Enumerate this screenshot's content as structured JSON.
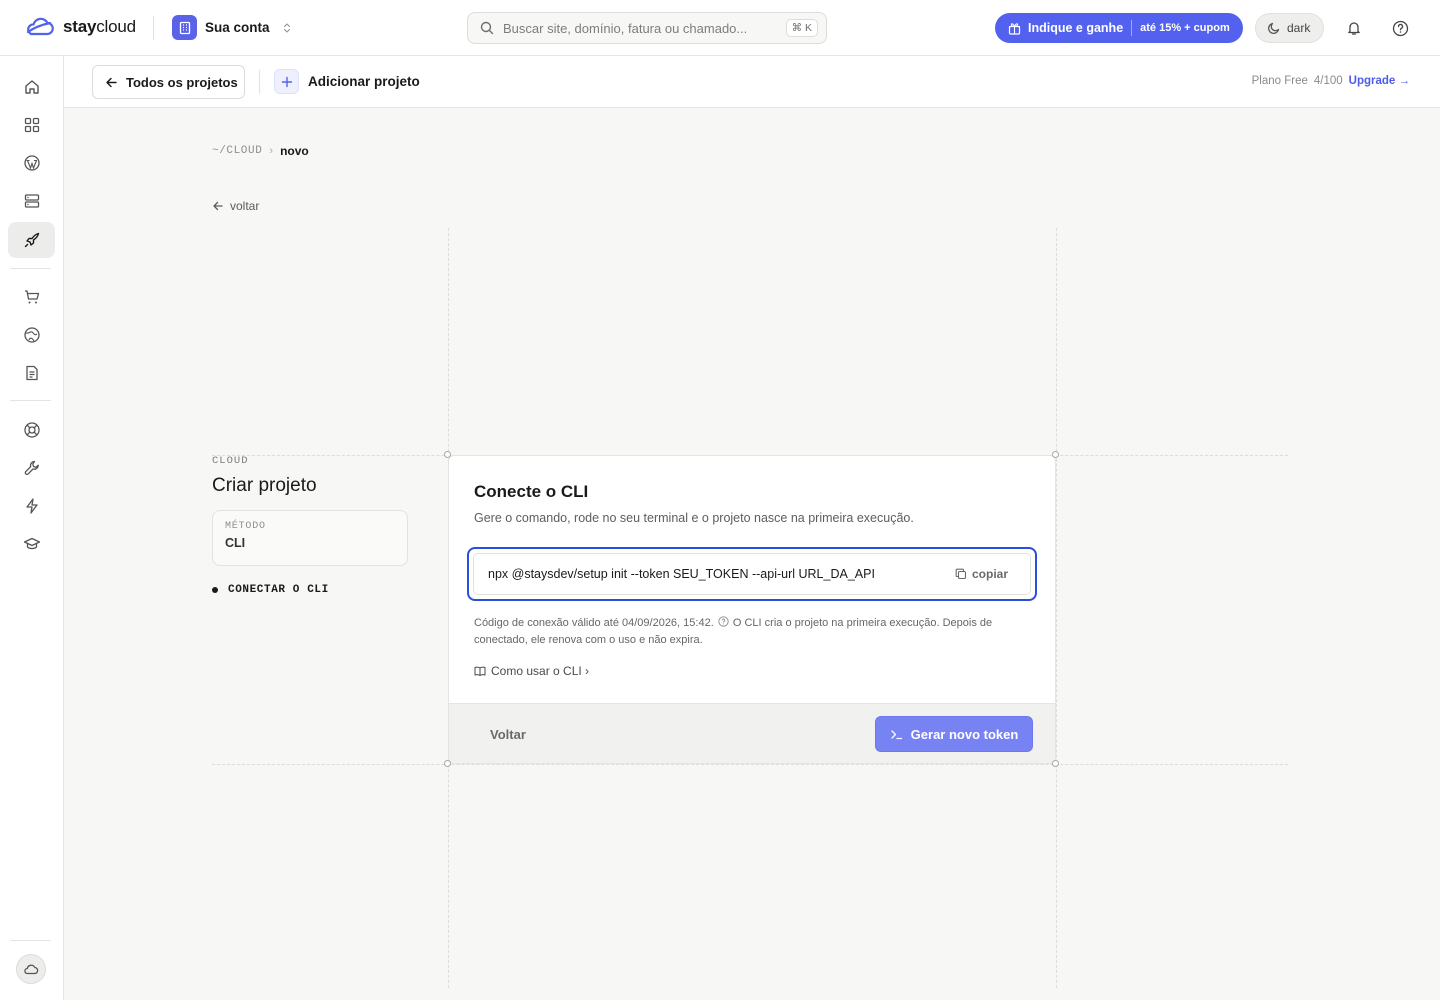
{
  "brand": {
    "name_bold": "stay",
    "name_light": "cloud"
  },
  "account": {
    "label": "Sua conta"
  },
  "search": {
    "placeholder": "Buscar site, domínio, fatura ou chamado...",
    "shortcut": "⌘ K"
  },
  "promo": {
    "label": "Indique e ganhe",
    "detail": "até 15% + cupom"
  },
  "theme_toggle": {
    "label": "dark"
  },
  "subheader": {
    "all_projects": "Todos os projetos",
    "add_project": "Adicionar projeto",
    "plan_label": "Plano Free",
    "plan_usage": "4/100",
    "upgrade": "Upgrade →"
  },
  "breadcrumb": {
    "root": "~/CLOUD",
    "separator": "›",
    "current": "novo"
  },
  "back_link": "voltar",
  "left_panel": {
    "eyebrow": "CLOUD",
    "title": "Criar projeto",
    "method_label": "MÉTODO",
    "method_value": "CLI",
    "step": "CONECTAR O CLI"
  },
  "card": {
    "title": "Conecte o CLI",
    "subtitle": "Gere o comando, rode no seu terminal e o projeto nasce na primeira execução.",
    "command": "npx @staysdev/setup init --token SEU_TOKEN --api-url URL_DA_API",
    "copy_label": "copiar",
    "note_part1": "Código de conexão válido até 04/09/2026, 15:42.",
    "note_part2": "O CLI cria o projeto na primeira execução. Depois de conectado, ele renova com o uso e não expira.",
    "howto": "Como usar o CLI ›",
    "back_button": "Voltar",
    "generate_button": "Gerar novo token"
  },
  "colors": {
    "accent": "#5262ee",
    "focus_ring": "#2c4fd9",
    "primary_button": "#7783f3"
  },
  "sidebar_icons": [
    "home-icon",
    "dashboard-icon",
    "wordpress-icon",
    "server-icon",
    "rocket-icon",
    "cart-icon",
    "globe-icon",
    "document-icon",
    "support-icon",
    "wrench-icon",
    "bolt-icon",
    "graduation-cap-icon",
    "cloud-icon"
  ]
}
